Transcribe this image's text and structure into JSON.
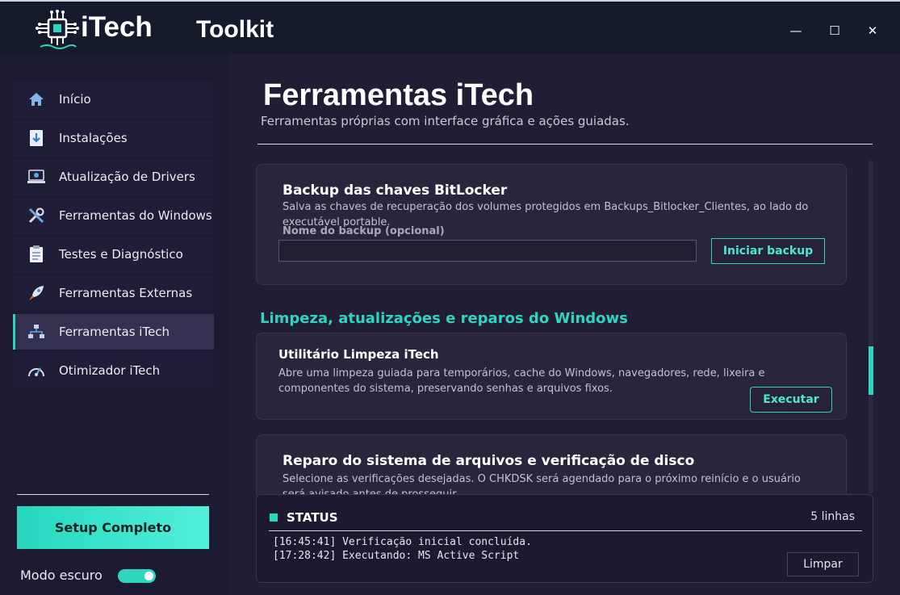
{
  "app": {
    "brand": "iTech",
    "title": "Toolkit"
  },
  "window_controls": {
    "minimize": "—",
    "maximize": "☐",
    "close": "✕"
  },
  "sidebar": {
    "items": [
      {
        "label": "Início",
        "icon": "home-icon"
      },
      {
        "label": "Instalações",
        "icon": "download-icon"
      },
      {
        "label": "Atualização de Drivers",
        "icon": "driver-icon"
      },
      {
        "label": "Ferramentas do Windows",
        "icon": "tools-icon"
      },
      {
        "label": "Testes e Diagnóstico",
        "icon": "clipboard-icon"
      },
      {
        "label": "Ferramentas Externas",
        "icon": "rocket-icon"
      },
      {
        "label": "Ferramentas iTech",
        "icon": "network-icon",
        "active": true
      },
      {
        "label": "Otimizador iTech",
        "icon": "gauge-icon"
      }
    ],
    "setup_button": "Setup Completo",
    "dark_mode_label": "Modo escuro",
    "dark_mode_on": true
  },
  "main": {
    "title": "Ferramentas iTech",
    "subtitle": "Ferramentas próprias com interface gráfica e ações guiadas.",
    "bitlocker": {
      "title": "Backup das chaves BitLocker",
      "description": "Salva as chaves de recuperação dos volumes protegidos em Backups_Bitlocker_Clientes, ao lado do executável portable.",
      "field_label": "Nome do backup (opcional)",
      "field_value": "",
      "button": "Iniciar backup"
    },
    "section_heading": "Limpeza, atualizações e reparos do Windows",
    "cleanup": {
      "title": "Utilitário Limpeza iTech",
      "description": "Abre uma limpeza guiada para temporários, cache do Windows, navegadores, rede, lixeira e componentes do sistema, preservando senhas e arquivos fixos.",
      "button": "Executar"
    },
    "repair": {
      "title": "Reparo do sistema de arquivos e verificação de disco",
      "description": "Selecione as verificações desejadas. O CHKDSK será agendado para o próximo reinício e o usuário será avisado antes de prosseguir."
    }
  },
  "status": {
    "title": "STATUS",
    "count": "5 linhas",
    "lines": [
      "[16:45:41] Verificação inicial concluída.",
      "[17:28:42] Executando: MS Active Script"
    ],
    "clear_button": "Limpar"
  },
  "colors": {
    "accent": "#2ed5bf",
    "background": "#211d35",
    "titlebar": "#151a2c"
  }
}
